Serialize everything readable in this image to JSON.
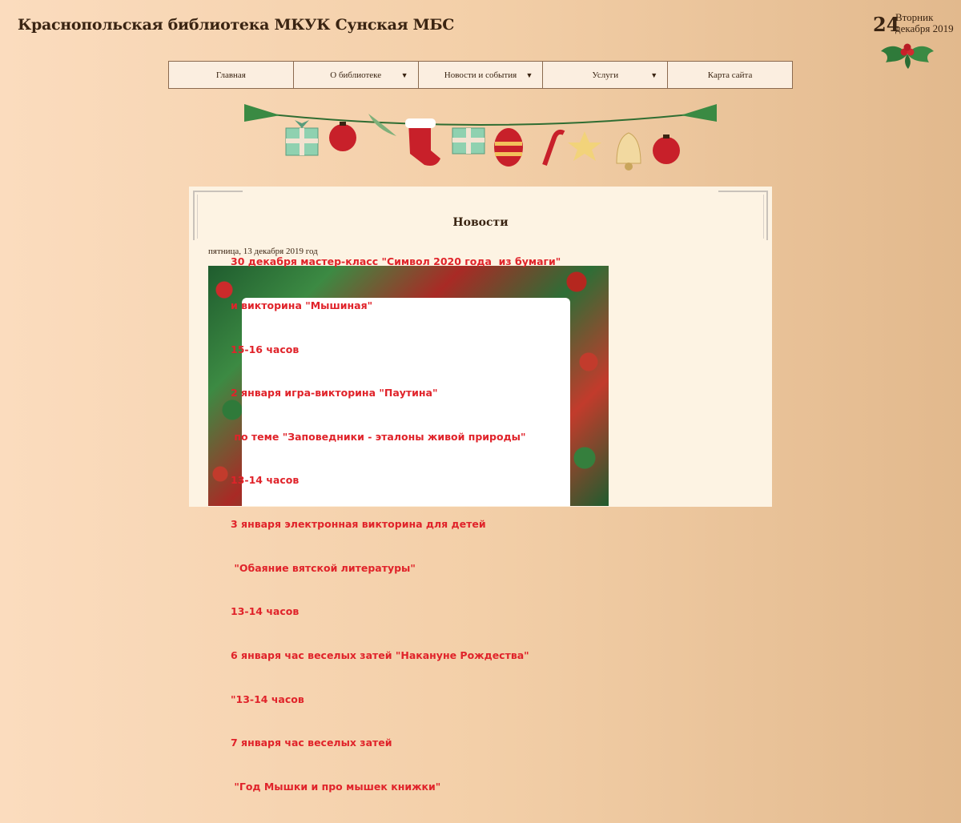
{
  "site": {
    "title": "Краснопольская библиотека МКУК Сунская МБС"
  },
  "date_widget": {
    "day": "24",
    "weekday": "Вторник",
    "month_year": "декабря 2019"
  },
  "nav": {
    "items": [
      {
        "label": "Главная",
        "has_dropdown": false
      },
      {
        "label": "О библиотеке",
        "has_dropdown": true
      },
      {
        "label": "Новости и события",
        "has_dropdown": true
      },
      {
        "label": "Услуги",
        "has_dropdown": true
      },
      {
        "label": "Карта сайта",
        "has_dropdown": false
      }
    ],
    "dropdown_glyph": "▼"
  },
  "content": {
    "heading": "Новости",
    "post_date": "пятница, 13 декабря 2019 год",
    "poster_lines": [
      "30 декабря мастер-класс \"Символ 2020 года  из бумаги\"",
      "и викторина \"Мышиная\"",
      "15-16 часов",
      "2 января игра-викторина \"Паутина\"",
      " по теме \"Заповедники - эталоны живой природы\"",
      "13-14 часов",
      "3 января электронная викторина для детей",
      " \"Обаяние вятской литературы\"",
      "13-14 часов",
      "6 января час веселых затей \"Накануне Рождества\"",
      "\"13-14 часов",
      "7 января час веселых затей",
      " \"Год Мышки и про мышек книжки\""
    ]
  },
  "colors": {
    "text_dark": "#3a2412",
    "poster_text": "#e0232a",
    "nav_bg": "#fbeee0",
    "content_bg": "#fdf3e3"
  }
}
